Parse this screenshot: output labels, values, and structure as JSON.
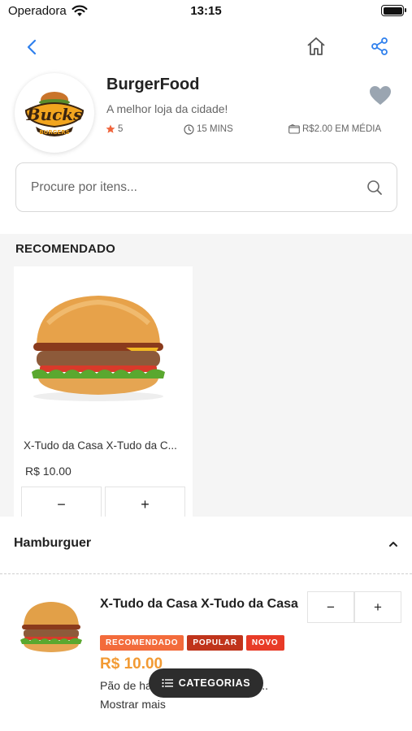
{
  "status_bar": {
    "carrier": "Operadora",
    "time": "13:15"
  },
  "store": {
    "name": "BurgerFood",
    "tagline": "A melhor loja da cidade!",
    "rating": "5",
    "delivery_time": "15 MINS",
    "avg_price": "R$2.00 EM MÉDIA",
    "logo_text": "Bucks Burgers"
  },
  "search": {
    "placeholder": "Procure por itens..."
  },
  "recommended": {
    "title": "RECOMENDADO",
    "items": [
      {
        "name": "X-Tudo da Casa X-Tudo da C...",
        "price": "R$ 10.00",
        "minus": "−",
        "plus": "+"
      }
    ]
  },
  "category": {
    "title": "Hamburguer",
    "items": [
      {
        "name": "X-Tudo da Casa X-Tudo da Casa",
        "badges": [
          "RECOMENDADO",
          "POPULAR",
          "NOVO"
        ],
        "price": "R$ 10.00",
        "description": "Pão de hambúrguer tradicional ...",
        "more": "Mostrar mais",
        "minus": "−",
        "plus": "+"
      }
    ]
  },
  "fab": {
    "label": "CATEGORIAS"
  },
  "colors": {
    "accent": "#2f80ed",
    "badge_recommended": "#f36b3b",
    "badge_popular": "#c0341b",
    "badge_new": "#e83b27",
    "price": "#f29a33",
    "fab": "#2d2d2d"
  },
  "icons": {
    "back": "chevron-left-icon",
    "home": "home-icon",
    "share": "share-icon",
    "favorite": "heart-icon",
    "search": "search-icon",
    "rating": "star-icon",
    "time": "clock-icon",
    "price": "wallet-icon",
    "collapse": "chevron-up-icon",
    "categories": "list-icon"
  }
}
